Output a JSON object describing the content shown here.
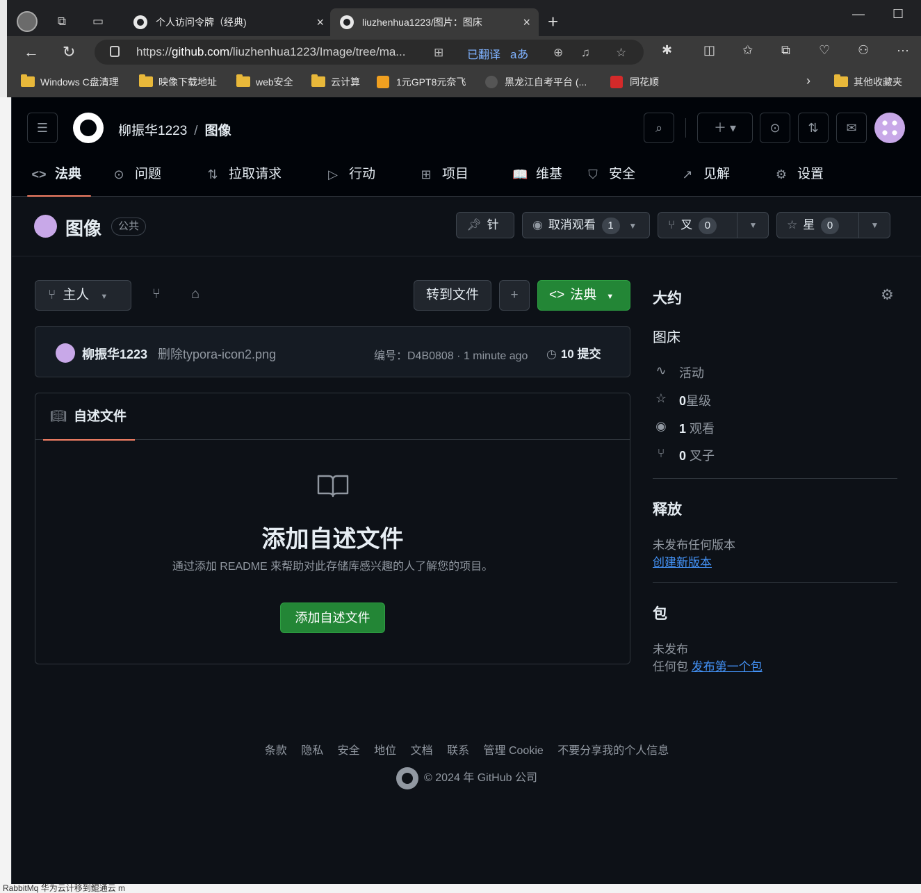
{
  "browser": {
    "tabs": [
      {
        "title": "个人访问令牌（经典)",
        "close": "×"
      },
      {
        "title": "liuzhenhua1223/图片：图床",
        "close": "×"
      }
    ],
    "new_tab": "+",
    "address": {
      "url_prefix": "https://",
      "url_host": "github.com",
      "url_path": "/liuzhenhua1223/Image/tree/ma...",
      "translated_label": "已翻译",
      "translate_glyph": "aあ"
    },
    "bookmarks": [
      {
        "label": "Windows C盘清理",
        "type": "folder"
      },
      {
        "label": "映像下载地址",
        "type": "folder"
      },
      {
        "label": "web安全",
        "type": "folder"
      },
      {
        "label": "云计算",
        "type": "folder"
      },
      {
        "label": "1元GPT8元奈飞",
        "type": "site"
      },
      {
        "label": "黑龙江自考平台 (...",
        "type": "site"
      },
      {
        "label": "同花顺",
        "type": "site"
      }
    ],
    "other_bookmarks": "其他收藏夹"
  },
  "header": {
    "owner": "柳振华1223",
    "separator": "/",
    "repo": "图像"
  },
  "repo_nav": [
    {
      "label": "法典",
      "icon": "<>"
    },
    {
      "label": "问题",
      "icon": "⊙"
    },
    {
      "label": "拉取请求",
      "icon": "⇅"
    },
    {
      "label": "行动",
      "icon": "▷"
    },
    {
      "label": "项目",
      "icon": "⊞"
    },
    {
      "label": "维基",
      "icon": "📖"
    },
    {
      "label": "安全",
      "icon": "⛉"
    },
    {
      "label": "见解",
      "icon": "↗"
    },
    {
      "label": "设置",
      "icon": "⚙"
    }
  ],
  "repo_head": {
    "name": "图像",
    "visibility": "公共",
    "pin_label": "针",
    "watch_label": "取消观看",
    "watch_count": "1",
    "fork_label": "叉",
    "fork_count": "0",
    "star_label": "星",
    "star_count": "0"
  },
  "toolbar": {
    "branch": "主人",
    "goto_file": "转到文件",
    "add": "+",
    "code": "法典"
  },
  "commit": {
    "author": "柳振华1223",
    "message": "删除typora-icon2.png",
    "hash": "编号：D4B0808 · 1 minute ago",
    "history": "10 提交"
  },
  "readme": {
    "tab": "自述文件",
    "title": "添加自述文件",
    "desc": "通过添加 README 来帮助对此存储库感兴趣的人了解您的项目。",
    "button": "添加自述文件"
  },
  "about": {
    "heading": "大约",
    "description": "图床",
    "activity": "活动",
    "stars_count": "0",
    "stars_label": "星级",
    "watching_count": "1",
    "watching_label": "观看",
    "forks_count": "0",
    "forks_label": "叉子"
  },
  "releases": {
    "heading": "释放",
    "none": "未发布任何版本",
    "create": "创建新版本"
  },
  "packages": {
    "heading": "包",
    "none_line1": "未发布",
    "none_line2": "任何包",
    "publish": "发布第一个包"
  },
  "footer": {
    "links": [
      "条款",
      "隐私",
      "安全",
      "地位",
      "文档",
      "联系",
      "管理 Cookie",
      "不要分享我的个人信息"
    ],
    "copyright": "© 2024 年 GitHub 公司"
  },
  "background": {
    "taskbar_text": "RabbitMq 华为云计移到鲲通云 m"
  }
}
